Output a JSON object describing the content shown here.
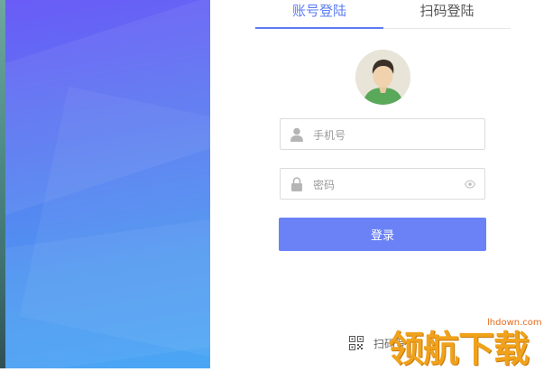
{
  "tabs": {
    "account": "账号登陆",
    "scan": "扫码登陆"
  },
  "form": {
    "phone_placeholder": "手机号",
    "password_placeholder": "密码",
    "login_label": "登录"
  },
  "scan_login": {
    "label": "扫码登"
  },
  "watermark": {
    "text": "领航下载",
    "url": "lhdown.com"
  },
  "colors": {
    "accent": "#5d7cf2",
    "button": "#6a82f6",
    "hero_top": "#6a5cf7",
    "hero_bottom": "#4aa7f5"
  }
}
